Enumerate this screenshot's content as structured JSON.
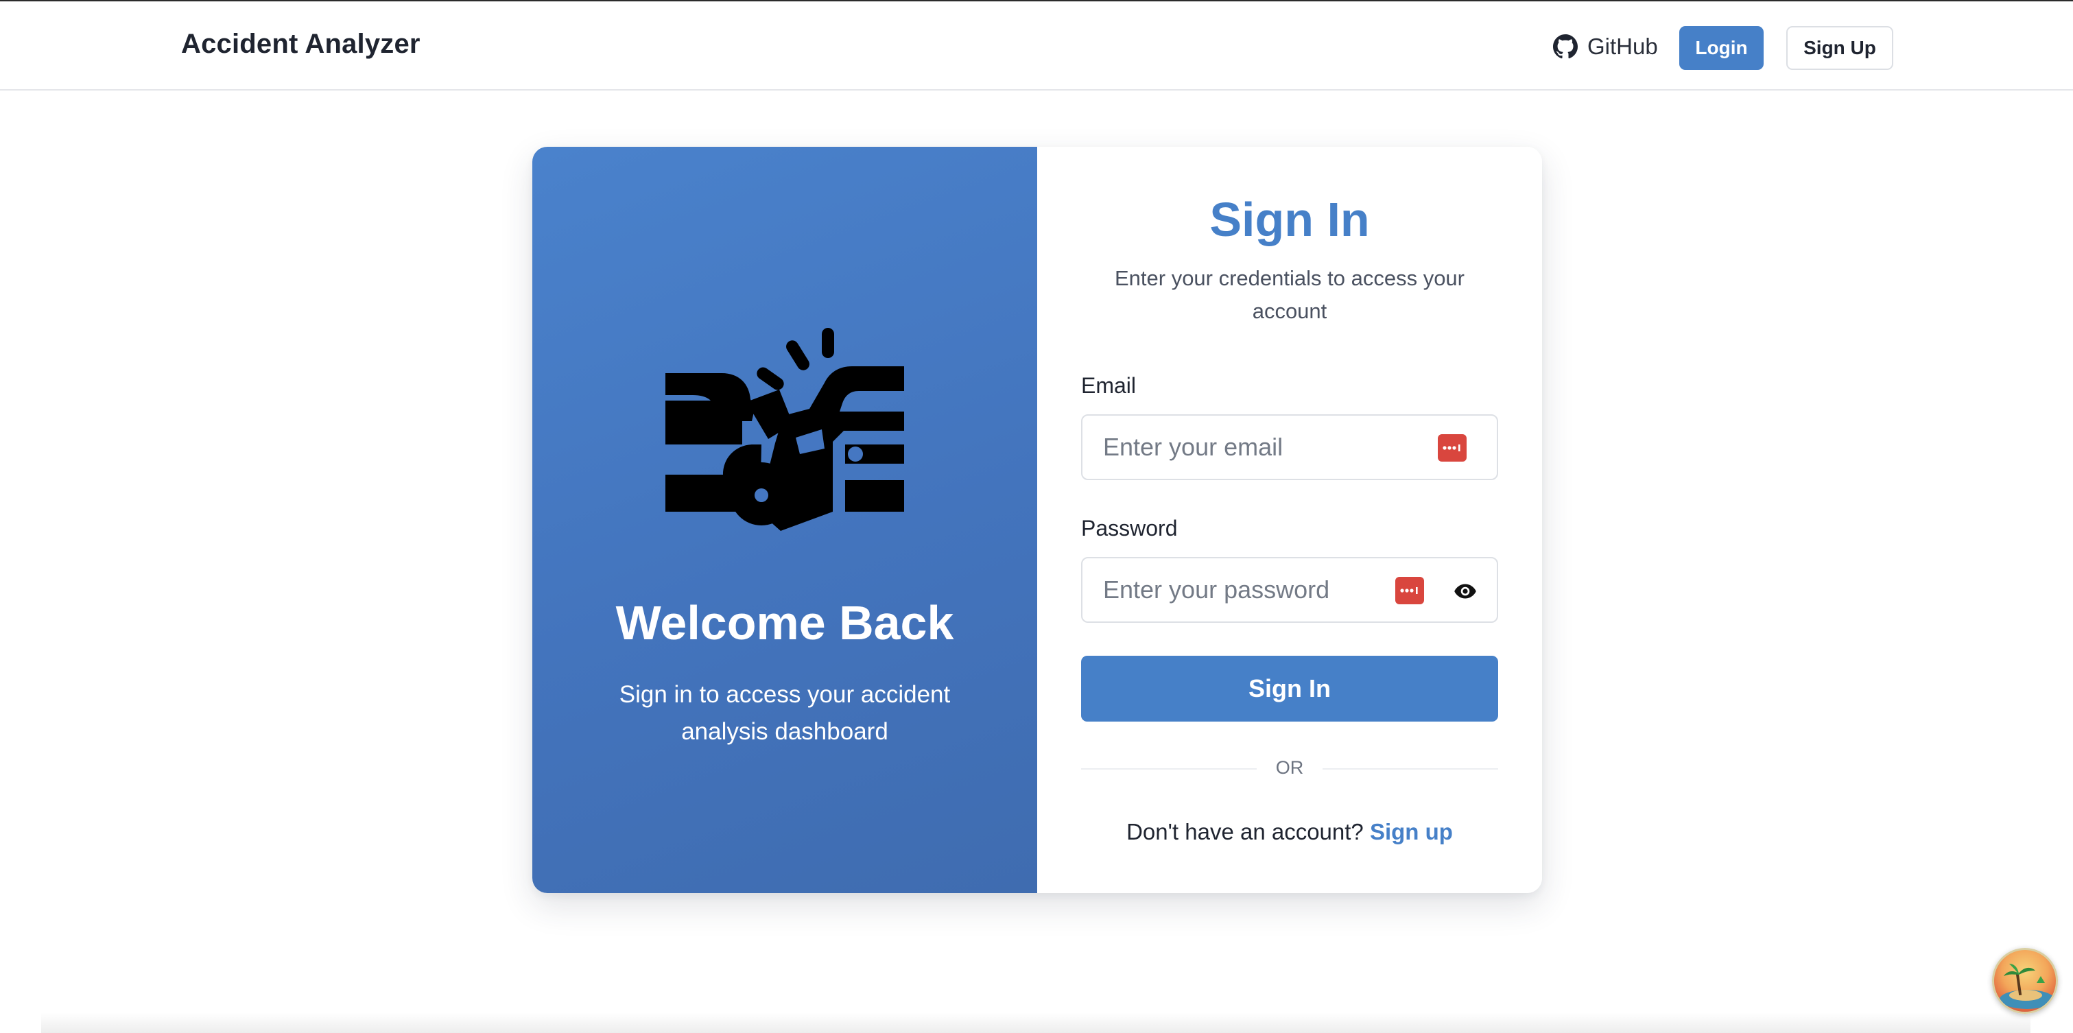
{
  "app": {
    "title": "Accident Analyzer"
  },
  "navbar": {
    "github_label": "GitHub",
    "login_label": "Login",
    "signup_label": "Sign Up"
  },
  "hero": {
    "icon": "car-crash-icon",
    "title": "Welcome Back",
    "subtitle": "Sign in to access your accident analysis dashboard"
  },
  "signin": {
    "title": "Sign In",
    "subtitle": "Enter your credentials to access your account",
    "email": {
      "label": "Email",
      "placeholder": "Enter your email",
      "value": ""
    },
    "password": {
      "label": "Password",
      "placeholder": "Enter your password",
      "value": ""
    },
    "submit_label": "Sign In",
    "divider_text": "OR",
    "no_account_text": "Don't have an account?",
    "signup_link": "Sign up"
  },
  "colors": {
    "accent": "#4680c8",
    "password_manager_badge": "#d9463e",
    "hero_gradient_start": "#4a82cc",
    "hero_gradient_end": "#3f6cb0"
  },
  "icons": {
    "github": "github-icon",
    "password_manager": "password-manager-icon",
    "show_password": "eye-icon",
    "extension": "extension-badge-icon"
  }
}
